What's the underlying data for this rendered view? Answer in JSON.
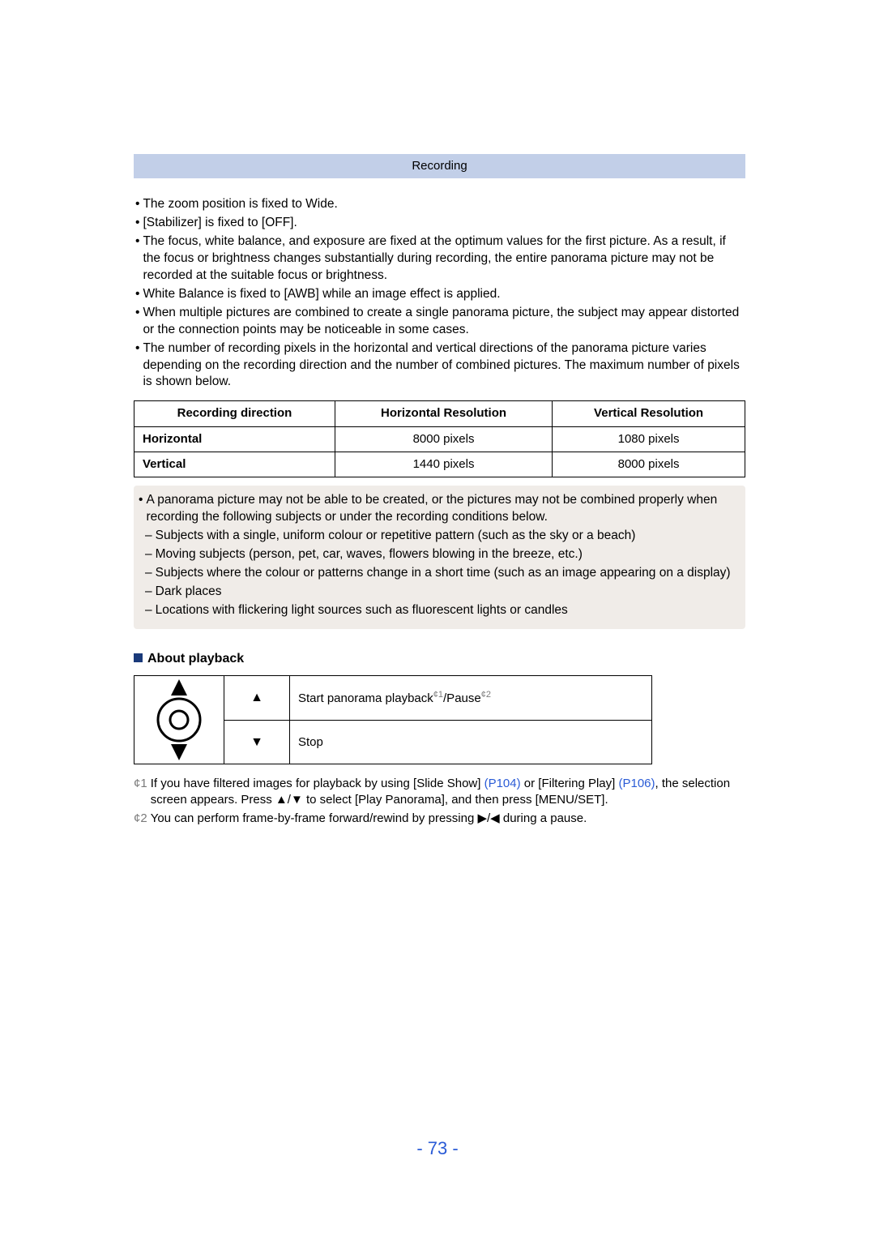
{
  "header": {
    "title": "Recording"
  },
  "bullets_top": [
    "The zoom position is fixed to Wide.",
    "[Stabilizer] is fixed to [OFF].",
    "The focus, white balance, and exposure are fixed at the optimum values for the first picture. As a result, if the focus or brightness changes substantially during recording, the entire panorama picture may not be recorded at the suitable focus or brightness.",
    "White Balance is fixed to [AWB] while an image effect is applied.",
    "When multiple pictures are combined to create a single panorama picture, the subject may appear distorted or the connection points may be noticeable in some cases.",
    "The number of recording pixels in the horizontal and vertical directions of the panorama picture varies depending on the recording direction and the number of combined pictures. The maximum number of pixels is shown below."
  ],
  "res_table": {
    "headers": [
      "Recording direction",
      "Horizontal Resolution",
      "Vertical Resolution"
    ],
    "rows": [
      {
        "dir": "Horizontal",
        "h": "8000 pixels",
        "v": "1080 pixels"
      },
      {
        "dir": "Vertical",
        "h": "1440 pixels",
        "v": "8000 pixels"
      }
    ]
  },
  "shaded": {
    "lead": "A panorama picture may not be able to be created, or the pictures may not be combined properly when recording the following subjects or under the recording conditions below.",
    "items": [
      "Subjects with a single, uniform colour or repetitive pattern (such as the sky or a beach)",
      "Moving subjects (person, pet, car, waves, flowers blowing in the breeze, etc.)",
      "Subjects where the colour or patterns change in a short time (such as an image appearing on a display)",
      "Dark places",
      "Locations with flickering light sources such as fluorescent lights or candles"
    ]
  },
  "subhead": "About playback",
  "pb_table": {
    "rows": [
      {
        "sym": "▲",
        "action_pre": "Start panorama playback",
        "sup1": "1",
        "mid": "/Pause",
        "sup2": "2"
      },
      {
        "sym": "▼",
        "action": "Stop"
      }
    ]
  },
  "footnotes": {
    "f1_pre": "If you have filtered images for playback by using [Slide Show] ",
    "f1_link1": "(P104)",
    "f1_mid": " or [Filtering Play] ",
    "f1_link2": "(P106)",
    "f1_post": ", the selection screen appears. Press ▲/▼ to select [Play Panorama], and then press [MENU/SET].",
    "f2": "You can perform frame-by-frame forward/rewind by pressing ▶/◀ during a pause."
  },
  "fn_marks": {
    "m1": "¢1",
    "m2": "¢2",
    "s1": "¢1",
    "s2": "¢2"
  },
  "page_number": "- 73 -"
}
